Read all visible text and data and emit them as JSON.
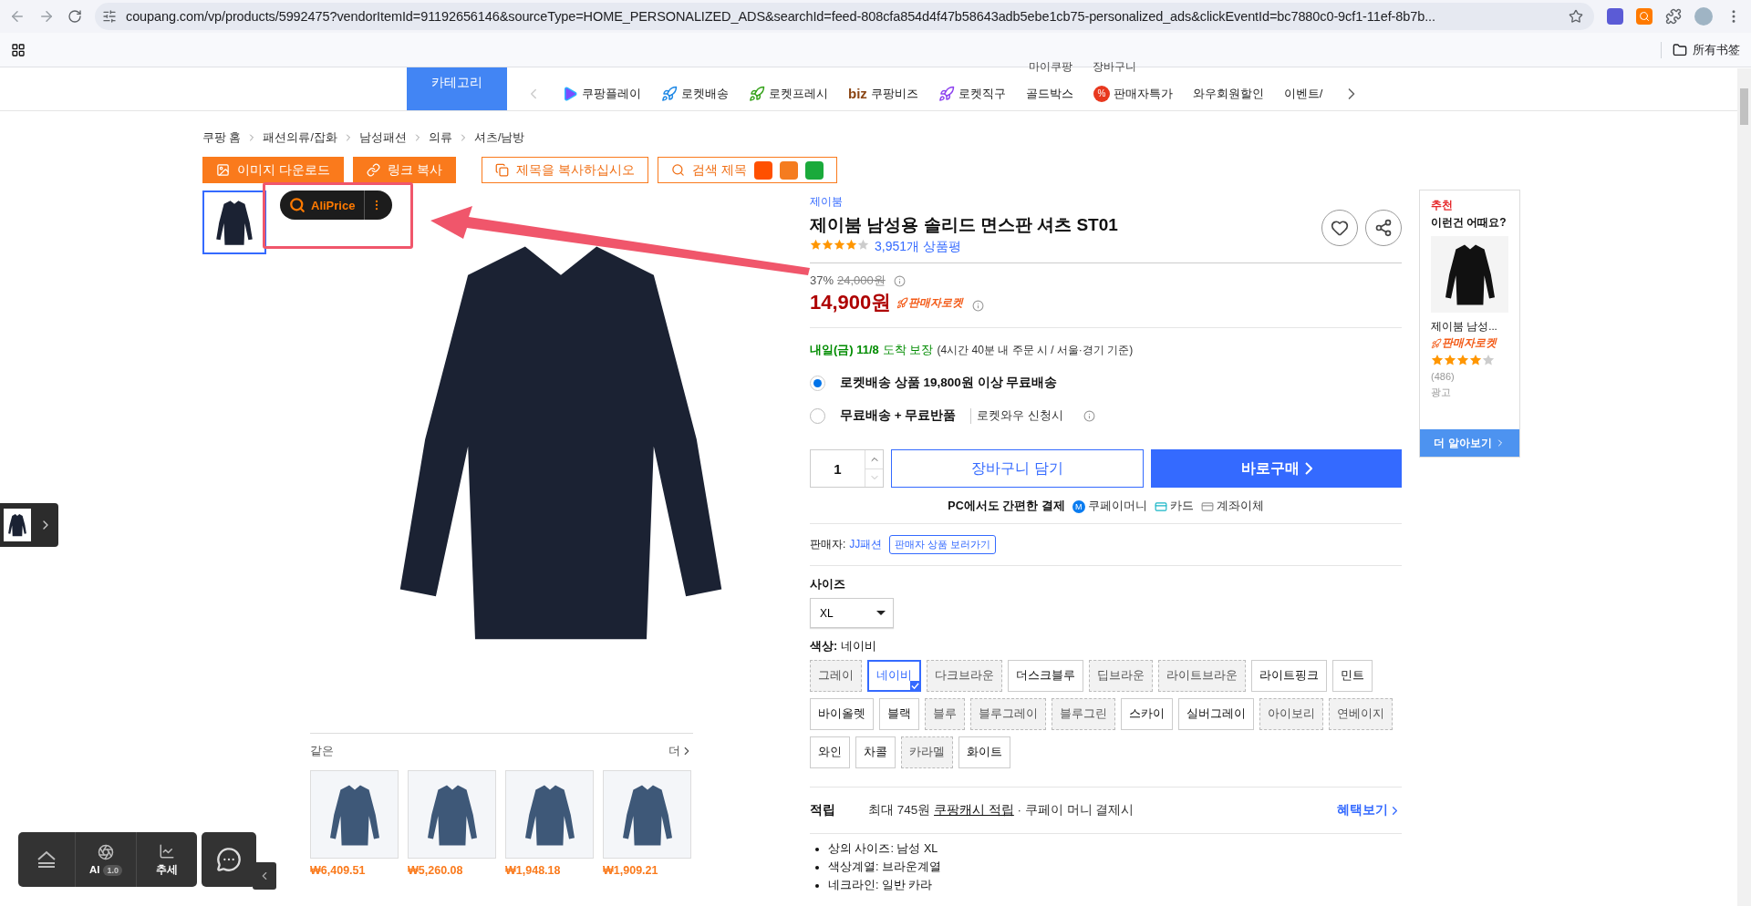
{
  "browser": {
    "url": "coupang.com/vp/products/5992475?vendorItemId=91192656146&sourceType=HOME_PERSONALIZED_ADS&searchId=feed-808cfa854d4f47b58643adb5ebe1cb75-personalized_ads&clickEventId=bc7880c0-9cf1-11ef-8b7b...",
    "bookmarks_label": "所有书签"
  },
  "header": {
    "category_button": "카테고리",
    "top_links": [
      "마이쿠팡",
      "장바구니"
    ],
    "nav": [
      {
        "label": "쿠팡플레이",
        "kind": "play"
      },
      {
        "label": "로켓배송",
        "kind": "rocket"
      },
      {
        "label": "로켓프레시",
        "kind": "fresh"
      },
      {
        "label": "쿠팡비즈",
        "kind": "biz",
        "badge": "biz"
      },
      {
        "label": "로켓직구",
        "kind": "global"
      },
      {
        "label": "골드박스",
        "kind": "plain"
      },
      {
        "label": "판매자특가",
        "kind": "deal",
        "badge": "%"
      },
      {
        "label": "와우회원할인",
        "kind": "plain"
      },
      {
        "label": "이벤트/",
        "kind": "plain"
      }
    ]
  },
  "breadcrumb": [
    "쿠팡 홈",
    "패션의류/잡화",
    "남성패션",
    "의류",
    "셔츠/남방"
  ],
  "toolbar": [
    {
      "label": "이미지 다운로드",
      "kind": "download"
    },
    {
      "label": "링크 복사",
      "kind": "link"
    },
    {
      "label": "제목을 복사하십시오",
      "kind": "copy"
    },
    {
      "label": "검색 제목",
      "kind": "search"
    }
  ],
  "aliprice": {
    "label": "AliPrice"
  },
  "product": {
    "brand": "제이붐",
    "title": "제이붐 남성용 솔리드 면스판 셔츠 ST01",
    "stars": 4,
    "reviews": "3,951개 상품평",
    "discount": "37%",
    "original_price": "24,000원",
    "price": "14,900원",
    "badge": "판매자로켓",
    "delivery": {
      "date": "내일(금) 11/8",
      "guarantee": "도착 보장",
      "note": "(4시간 40분  내 주문 시 / 서울·경기 기준)"
    },
    "shipping": [
      {
        "label": "로켓배송 상품 19,800원 이상 무료배송",
        "selected": true
      },
      {
        "label": "무료배송 + 무료반품",
        "extra": "로켓와우 신청시",
        "selected": false
      }
    ],
    "quantity": "1",
    "cart_button": "장바구니 담기",
    "buy_button": "바로구매",
    "payment": {
      "label": "PC에서도 간편한 결제",
      "methods": [
        {
          "label": "쿠페이머니",
          "kind": "money",
          "badge": "M"
        },
        {
          "label": "카드",
          "kind": "card"
        },
        {
          "label": "계좌이체",
          "kind": "bank"
        }
      ]
    },
    "seller": {
      "label": "판매자:",
      "name": "JJ패션",
      "link": "판매자 상품 보러가기"
    },
    "size": {
      "label": "사이즈",
      "value": "XL"
    },
    "color": {
      "label": "색상:",
      "value": "네이비",
      "options": [
        {
          "label": "그레이",
          "selected": false,
          "available": false
        },
        {
          "label": "네이비",
          "selected": true,
          "available": true
        },
        {
          "label": "다크브라운",
          "selected": false,
          "available": false
        },
        {
          "label": "더스크블루",
          "selected": false,
          "available": true
        },
        {
          "label": "딥브라운",
          "selected": false,
          "available": false
        },
        {
          "label": "라이트브라운",
          "selected": false,
          "available": false
        },
        {
          "label": "라이트핑크",
          "selected": false,
          "available": true
        },
        {
          "label": "민트",
          "selected": false,
          "available": true
        },
        {
          "label": "바이올렛",
          "selected": false,
          "available": true
        },
        {
          "label": "블랙",
          "selected": false,
          "available": true
        },
        {
          "label": "블루",
          "selected": false,
          "available": false
        },
        {
          "label": "블루그레이",
          "selected": false,
          "available": false
        },
        {
          "label": "블루그린",
          "selected": false,
          "available": false
        },
        {
          "label": "스카이",
          "selected": false,
          "available": true
        },
        {
          "label": "실버그레이",
          "selected": false,
          "available": true
        },
        {
          "label": "아이보리",
          "selected": false,
          "available": false
        },
        {
          "label": "연베이지",
          "selected": false,
          "available": false
        },
        {
          "label": "와인",
          "selected": false,
          "available": true
        },
        {
          "label": "차콜",
          "selected": false,
          "available": true
        },
        {
          "label": "카라멜",
          "selected": false,
          "available": false
        },
        {
          "label": "화이트",
          "selected": false,
          "available": true
        }
      ]
    },
    "reward": {
      "label": "적립",
      "prefix": "최대 745원",
      "link": "쿠팡캐시 적립",
      "suffix": "· 쿠페이 머니 결제시",
      "more": "혜택보기"
    },
    "specs": [
      "상의 사이즈: 남성 XL",
      "색상계열: 브라운계열",
      "네크라인: 일반 카라"
    ]
  },
  "similar": {
    "title": "같은",
    "more": "더",
    "items": [
      {
        "price": "₩6,409.51"
      },
      {
        "price": "₩5,260.08"
      },
      {
        "price": "₩1,948.18"
      },
      {
        "price": "₩1,909.21"
      }
    ]
  },
  "ad": {
    "heading": "추천",
    "subheading": "이런건 어때요?",
    "name": "제이붐 남성...",
    "badge": "판매자로켓",
    "stars": 4,
    "count": "(486)",
    "ad_label": "광고",
    "more": "더 알아보기"
  },
  "float_toolbar": [
    {
      "kind": "collapse"
    },
    {
      "kind": "ai",
      "label": "AI",
      "badge": "1.0"
    },
    {
      "kind": "trend",
      "label": "추세"
    }
  ]
}
